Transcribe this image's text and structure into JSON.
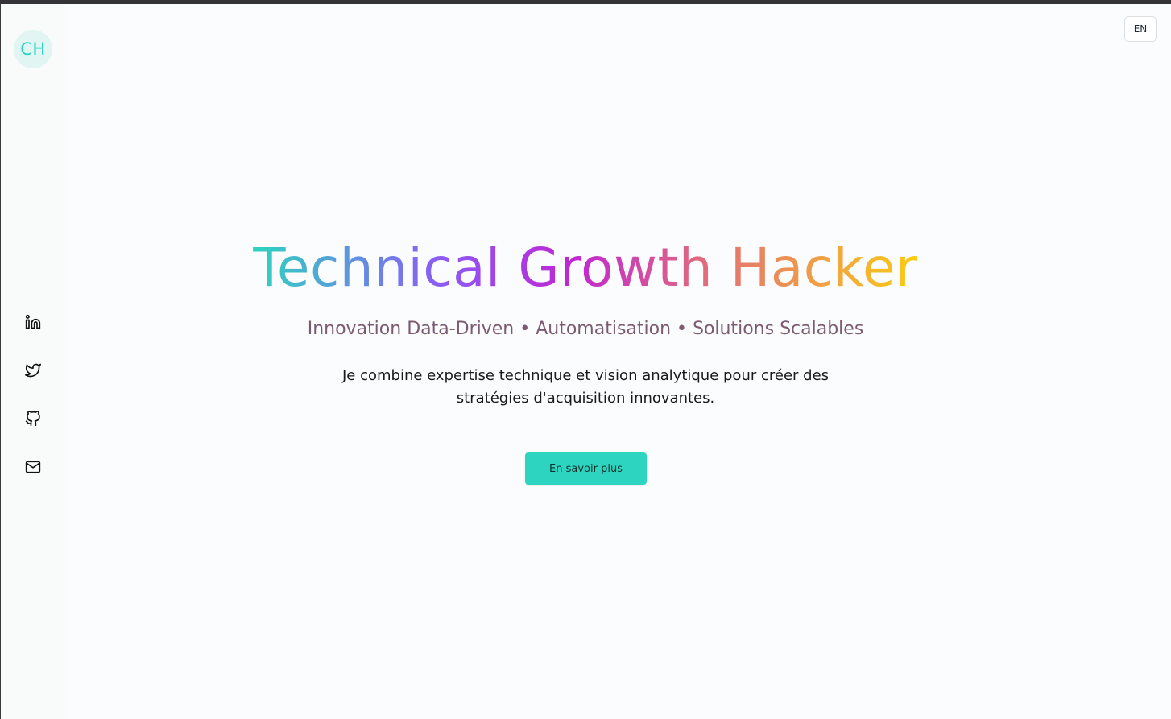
{
  "logo": {
    "initials": "CH"
  },
  "language": {
    "label": "EN"
  },
  "social": [
    {
      "icon": "linkedin-icon"
    },
    {
      "icon": "twitter-icon"
    },
    {
      "icon": "github-icon"
    },
    {
      "icon": "mail-icon"
    }
  ],
  "hero": {
    "title": "Technical Growth Hacker",
    "subtitle": "Innovation Data-Driven • Automatisation • Solutions Scalables",
    "description": "Je combine expertise technique et vision analytique pour créer des stratégies d'acquisition innovantes.",
    "cta_label": "En savoir plus"
  },
  "colors": {
    "accent": "#2dd4bf",
    "subtitle": "#7b5a72",
    "gradient": [
      "#2dd4bf",
      "#8b5cf6",
      "#c026d3",
      "#e57373",
      "#facc15"
    ]
  }
}
